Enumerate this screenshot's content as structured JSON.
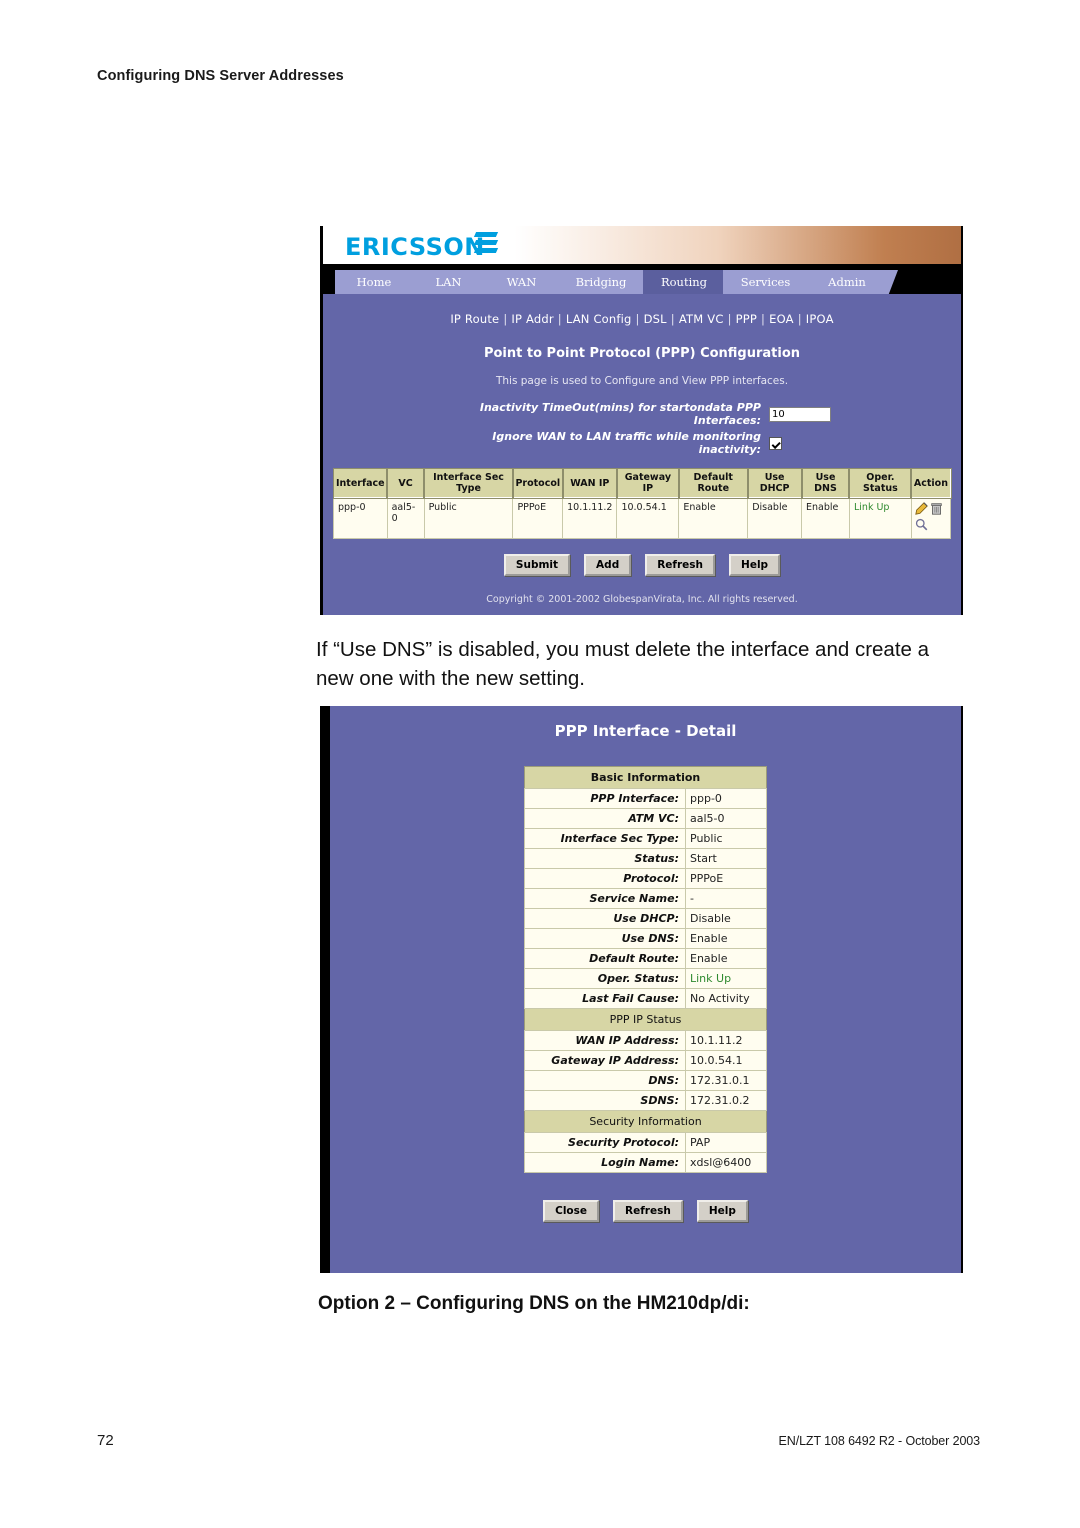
{
  "document": {
    "running_header": "Configuring DNS Server Addresses",
    "paragraph": "If “Use DNS” is disabled, you must delete the interface and create a new one with the new setting.",
    "section_heading": "Option 2 – Configuring DNS on the HM210dp/di:",
    "page_number": "72",
    "footer_reference": "EN/LZT 108 6492 R2  - October 2003"
  },
  "colors": {
    "router_bg_purple": "#6366a8",
    "tab_inactive": "#9b9ed2",
    "tab_active": "#5b5f9e",
    "table_header_khaki": "#d7d6a5",
    "table_cell_cream": "#fffdf0",
    "brand_blue": "#009fdf",
    "link_up_green": "#2f8a2f"
  },
  "ppp_config": {
    "brand": "ERICSSON",
    "tabs": [
      {
        "label": "Home",
        "active": false
      },
      {
        "label": "LAN",
        "active": false
      },
      {
        "label": "WAN",
        "active": false
      },
      {
        "label": "Bridging",
        "active": false
      },
      {
        "label": "Routing",
        "active": true
      },
      {
        "label": "Services",
        "active": false
      },
      {
        "label": "Admin",
        "active": false
      }
    ],
    "subnav": [
      "IP Route",
      "IP Addr",
      "LAN Config",
      "DSL",
      "ATM VC",
      "PPP",
      "EOA",
      "IPOA"
    ],
    "title": "Point to Point Protocol (PPP) Configuration",
    "subtitle": "This page is used to Configure and View PPP interfaces.",
    "inactivity": {
      "timeout_label": "Inactivity TimeOut(mins) for startondata PPP Interfaces:",
      "timeout_value": "10",
      "ignore_label": "Ignore WAN to LAN traffic while monitoring inactivity:",
      "ignore_checked": true
    },
    "table": {
      "columns": [
        "Interface",
        "VC",
        "Interface Sec Type",
        "Protocol",
        "WAN IP",
        "Gateway IP",
        "Default Route",
        "Use DHCP",
        "Use DNS",
        "Oper. Status",
        "Action"
      ],
      "rows": [
        {
          "interface": "ppp-0",
          "vc": "aal5-0",
          "sec_type": "Public",
          "protocol": "PPPoE",
          "wan_ip": "10.1.11.2",
          "gateway_ip": "10.0.54.1",
          "default_route": "Enable",
          "use_dhcp": "Disable",
          "use_dns": "Enable",
          "oper_status": "Link Up",
          "actions": [
            "edit-pencil-icon",
            "delete-trash-icon",
            "view-magnifier-icon"
          ]
        }
      ]
    },
    "buttons": [
      "Submit",
      "Add",
      "Refresh",
      "Help"
    ],
    "copyright": "Copyright © 2001-2002 GlobespanVirata, Inc. All rights reserved."
  },
  "ppp_detail": {
    "title": "PPP Interface - Detail",
    "sections": [
      {
        "heading": "Basic Information",
        "bold_heading": true,
        "rows": [
          {
            "label": "PPP Interface:",
            "value": "ppp-0",
            "green": false
          },
          {
            "label": "ATM VC:",
            "value": "aal5-0",
            "green": false
          },
          {
            "label": "Interface Sec Type:",
            "value": "Public",
            "green": false
          },
          {
            "label": "Status:",
            "value": "Start",
            "green": false
          },
          {
            "label": "Protocol:",
            "value": "PPPoE",
            "green": false
          },
          {
            "label": "Service Name:",
            "value": "-",
            "green": false
          },
          {
            "label": "Use DHCP:",
            "value": "Disable",
            "green": false
          },
          {
            "label": "Use DNS:",
            "value": "Enable",
            "green": false
          },
          {
            "label": "Default Route:",
            "value": "Enable",
            "green": false
          },
          {
            "label": "Oper. Status:",
            "value": "Link Up",
            "green": true
          },
          {
            "label": "Last Fail Cause:",
            "value": "No Activity",
            "green": false
          }
        ]
      },
      {
        "heading": "PPP IP Status",
        "bold_heading": false,
        "rows": [
          {
            "label": "WAN IP Address:",
            "value": "10.1.11.2",
            "green": false
          },
          {
            "label": "Gateway IP Address:",
            "value": "10.0.54.1",
            "green": false
          },
          {
            "label": "DNS:",
            "value": "172.31.0.1",
            "green": false
          },
          {
            "label": "SDNS:",
            "value": "172.31.0.2",
            "green": false
          }
        ]
      },
      {
        "heading": "Security Information",
        "bold_heading": false,
        "rows": [
          {
            "label": "Security Protocol:",
            "value": "PAP",
            "green": false
          },
          {
            "label": "Login Name:",
            "value": "xdsl@6400",
            "green": false
          }
        ]
      }
    ],
    "buttons": [
      "Close",
      "Refresh",
      "Help"
    ]
  }
}
